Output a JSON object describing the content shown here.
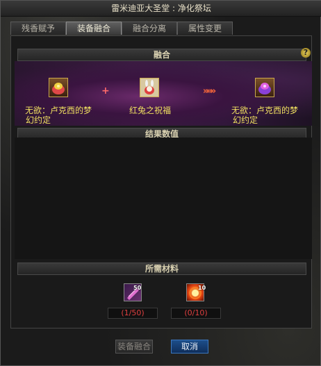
{
  "window": {
    "title": "雷米迪亚大圣堂 : 净化祭坛"
  },
  "tabs": [
    {
      "label": "残香赋予"
    },
    {
      "label": "装备融合"
    },
    {
      "label": "融合分离"
    },
    {
      "label": "属性变更"
    }
  ],
  "fusion": {
    "header": "融合",
    "help": "?",
    "item_a": {
      "name_line1": "无欲：卢克西的梦",
      "name_line2": "幻约定"
    },
    "plus": "+",
    "item_b": {
      "name": "红兔之祝福"
    },
    "arrows": "»»»",
    "result": {
      "name_line1": "无欲：卢克西的梦",
      "name_line2": "幻约定"
    }
  },
  "result_section": {
    "header": "结果数值"
  },
  "materials": {
    "header": "所需材料",
    "items": [
      {
        "badge": "50",
        "qty": "(1/50)"
      },
      {
        "badge": "10",
        "qty": "(0/10)"
      }
    ]
  },
  "buttons": {
    "fuse": "装备融合",
    "cancel": "取消"
  },
  "colors": {
    "item_name": "#f0e060",
    "insufficient": "#e04040",
    "cancel_button": "#1d4e8a"
  }
}
